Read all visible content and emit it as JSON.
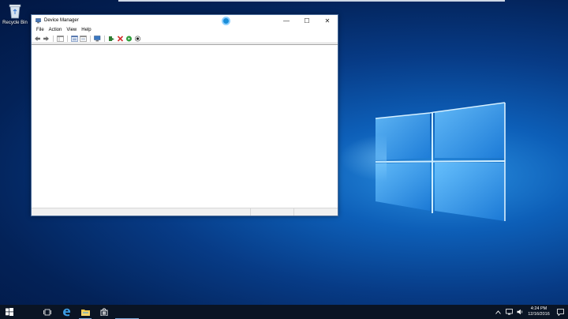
{
  "desktop": {
    "icons": [
      {
        "label": "Recycle Bin",
        "icon": "recycle-bin-icon"
      }
    ]
  },
  "window": {
    "title": "Device Manager",
    "controls": {
      "minimize": "—",
      "maximize": "☐",
      "close": "✕"
    },
    "menu": [
      "File",
      "Action",
      "View",
      "Help"
    ],
    "toolbar": [
      "back-arrow-icon",
      "forward-arrow-icon",
      "show-hide-tree-icon",
      "properties-icon",
      "help-icon",
      "scan-hardware-icon",
      "update-driver-icon",
      "uninstall-icon",
      "enable-device-icon",
      "disable-device-icon"
    ]
  },
  "taskbar": {
    "buttons": [
      "start-icon",
      "task-view-icon",
      "edge-icon",
      "file-explorer-icon",
      "store-icon"
    ],
    "clock": {
      "time": "4:24 PM",
      "date": "12/16/2016"
    },
    "colors": {
      "accent": "#7aa7d6",
      "background": "#0a1424"
    }
  }
}
